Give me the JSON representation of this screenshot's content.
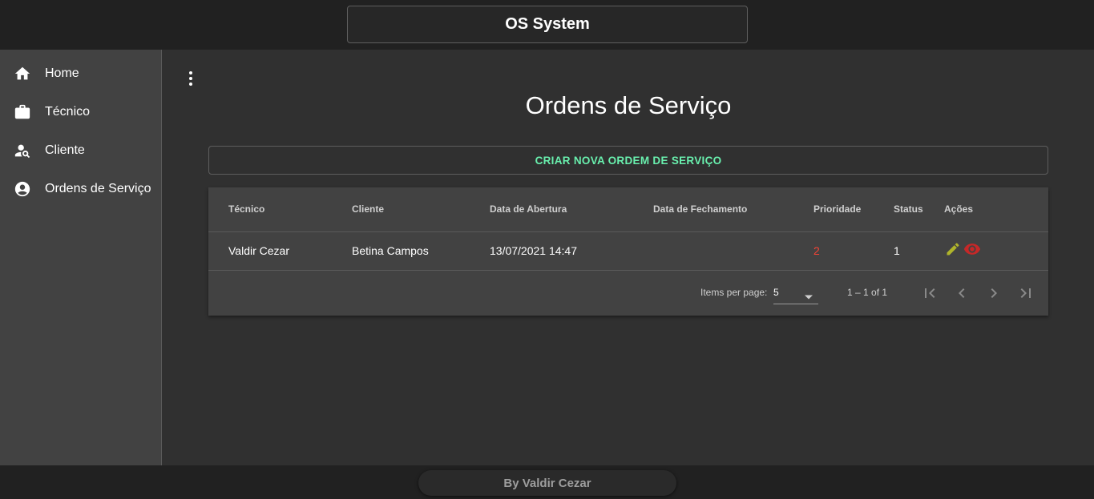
{
  "header": {
    "title": "OS System"
  },
  "sidebar": {
    "items": [
      {
        "label": "Home",
        "icon": "home-icon"
      },
      {
        "label": "Técnico",
        "icon": "briefcase-icon"
      },
      {
        "label": "Cliente",
        "icon": "person-search-icon"
      },
      {
        "label": "Ordens de Serviço",
        "icon": "account-circle-icon"
      }
    ]
  },
  "main": {
    "menu_icon": "more-vert-icon",
    "title": "Ordens de Serviço",
    "create_button": "CRIAR NOVA ORDEM DE SERVIÇO",
    "accent_color": "#69f0ae"
  },
  "table": {
    "columns": [
      "Técnico",
      "Cliente",
      "Data de Abertura",
      "Data de Fechamento",
      "Prioridade",
      "Status",
      "Ações"
    ],
    "rows": [
      {
        "tecnico": "Valdir Cezar",
        "cliente": "Betina Campos",
        "data_abertura": "13/07/2021 14:47",
        "data_fechamento": "",
        "prioridade": "2",
        "status": "1",
        "actions": [
          "edit-icon",
          "view-icon"
        ]
      }
    ],
    "priority_color": "#f44336",
    "edit_icon_color": "#afb42b",
    "view_icon_color": "#c62828"
  },
  "paginator": {
    "items_per_page_label": "Items per page:",
    "items_per_page_value": "5",
    "range_label": "1 – 1 of 1"
  },
  "footer": {
    "text": "By Valdir Cezar"
  }
}
